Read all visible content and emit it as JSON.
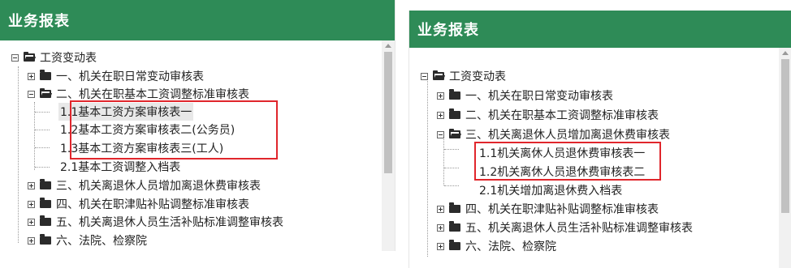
{
  "left": {
    "title": "业务报表",
    "tree": {
      "root": "工资变动表",
      "items": [
        {
          "label": "一、机关在职日常变动审核表"
        },
        {
          "label": "二、机关在职基本工资调整标准审核表"
        },
        {
          "label": "1.1基本工资方案审核表一"
        },
        {
          "label": "1.2基本工资方案审核表二(公务员)"
        },
        {
          "label": "1.3基本工资方案审核表三(工人)"
        },
        {
          "label": "2.1基本工资调整入档表"
        },
        {
          "label": "三、机关离退休人员增加离退休费审核表"
        },
        {
          "label": "四、机关在职津贴补贴调整标准审核表"
        },
        {
          "label": "五、机关离退休人员生活补贴标准调整审核表"
        },
        {
          "label": "六、法院、检察院"
        }
      ]
    }
  },
  "right": {
    "title": "业务报表",
    "tree": {
      "root": "工资变动表",
      "items": [
        {
          "label": "一、机关在职日常变动审核表"
        },
        {
          "label": "二、机关在职基本工资调整标准审核表"
        },
        {
          "label": "三、机关离退休人员增加离退休费审核表"
        },
        {
          "label": "1.1机关离休人员退休费审核表一"
        },
        {
          "label": "1.2机关离休人员退休费审核表二"
        },
        {
          "label": "2.1机关增加离退休费入档表"
        },
        {
          "label": "四、机关在职津贴补贴调整标准审核表"
        },
        {
          "label": "五、机关离退休人员生活补贴标准调整审核表"
        },
        {
          "label": "六、法院、检察院"
        }
      ]
    }
  },
  "colors": {
    "header_bg": "#2e8b57",
    "highlight_border": "#e0262c"
  }
}
